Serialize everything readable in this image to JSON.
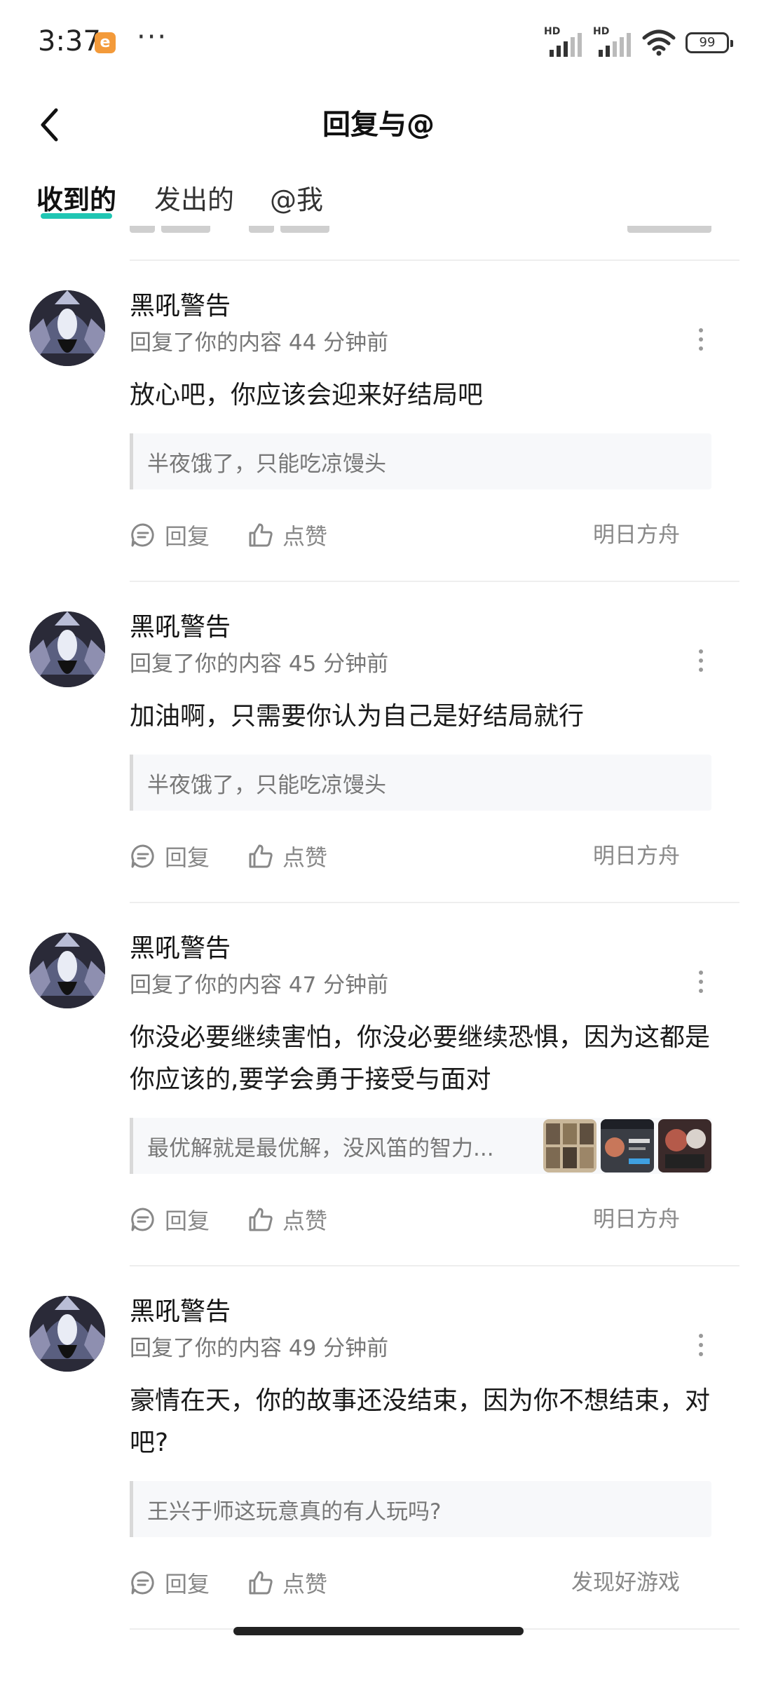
{
  "status_bar": {
    "time": "3:37",
    "app_icon_letter": "e",
    "more_dots": "···",
    "network_1": "HD",
    "network_2": "HD",
    "battery": "99"
  },
  "header": {
    "title": "回复与@",
    "back_icon": "chevron-left-icon"
  },
  "tabs": [
    {
      "label": "收到的",
      "active": true
    },
    {
      "label": "发出的",
      "active": false
    },
    {
      "label": "@我",
      "active": false
    }
  ],
  "colors": {
    "accent": "#20c6b3",
    "text_secondary": "#777777",
    "divider": "#eeeeee"
  },
  "actions": {
    "reply_label": "回复",
    "like_label": "点赞"
  },
  "items": [
    {
      "name": "黑吼警告",
      "meta": "回复了你的内容 44 分钟前",
      "content": "放心吧，你应该会迎来好结局吧",
      "quote": "半夜饿了，只能吃凉馒头",
      "tag": "明日方舟"
    },
    {
      "name": "黑吼警告",
      "meta": "回复了你的内容 45 分钟前",
      "content": "加油啊，只需要你认为自己是好结局就行",
      "quote": "半夜饿了，只能吃凉馒头",
      "tag": "明日方舟"
    },
    {
      "name": "黑吼警告",
      "meta": "回复了你的内容 47 分钟前",
      "content": "你没必要继续害怕，你没必要继续恐惧，因为这都是你应该的,要学会勇于接受与面对",
      "quote": "最优解就是最优解，没风笛的智力...",
      "tag": "明日方舟"
    },
    {
      "name": "黑吼警告",
      "meta": "回复了你的内容 49 分钟前",
      "content": "豪情在天，你的故事还没结束，因为你不想结束，对吧?",
      "quote": "王兴于师这玩意真的有人玩吗?",
      "tag": "发现好游戏"
    }
  ]
}
